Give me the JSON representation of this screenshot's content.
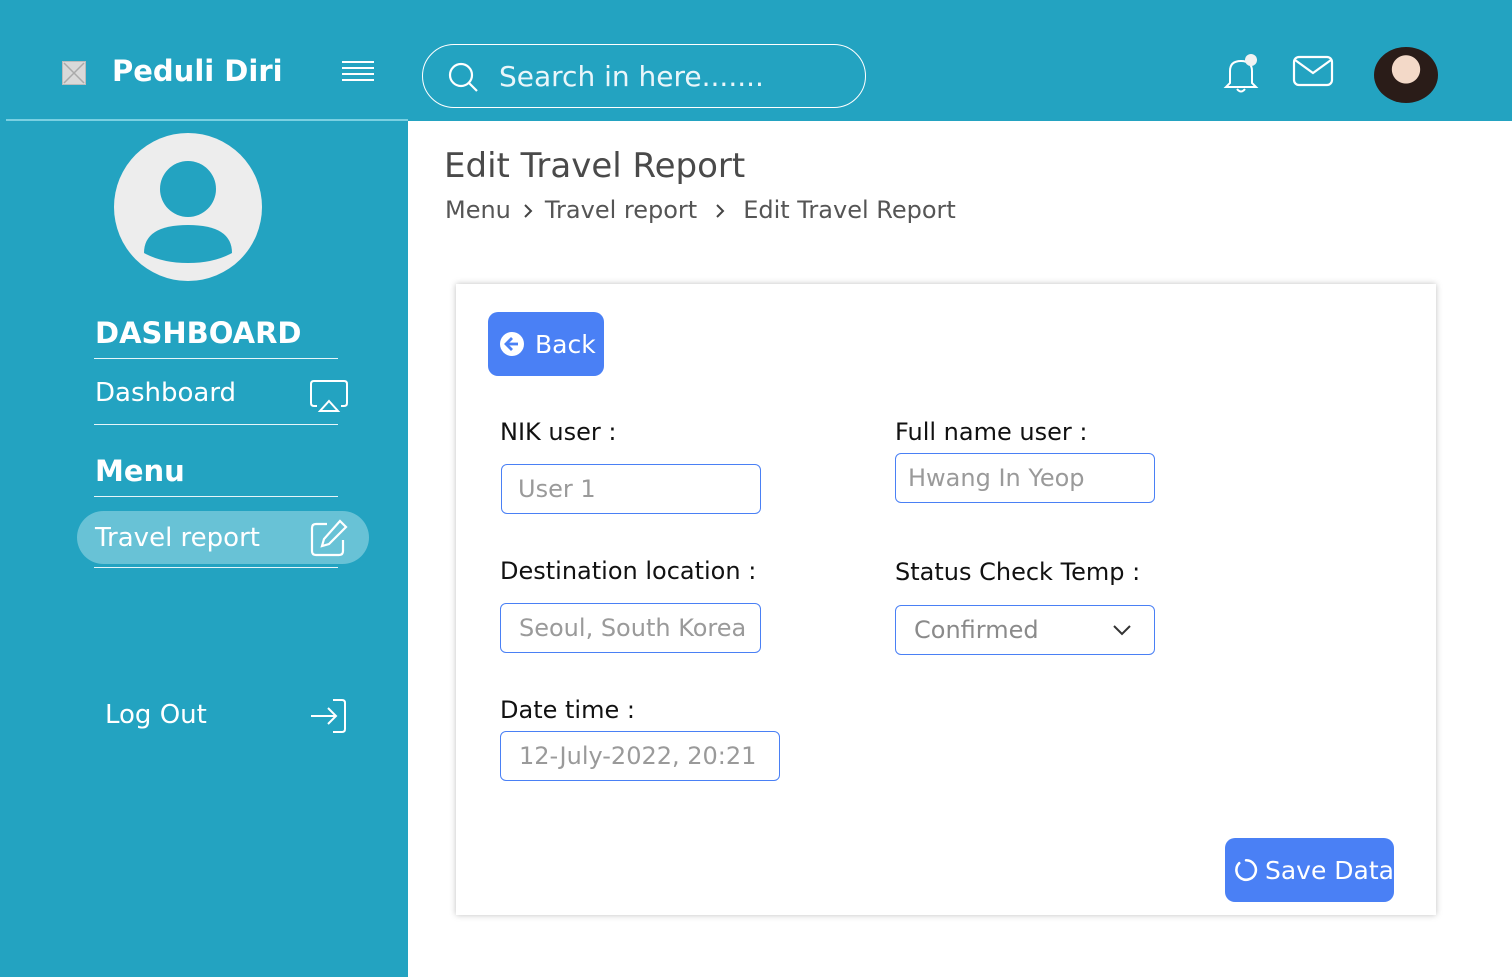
{
  "app": {
    "title": "Peduli Diri"
  },
  "search": {
    "placeholder": "Search in here......."
  },
  "sidebar": {
    "section_dashboard": "DASHBOARD",
    "dashboard_item": "Dashboard",
    "section_menu": "Menu",
    "travel_report_item": "Travel report",
    "logout": "Log Out"
  },
  "page": {
    "title": "Edit Travel Report",
    "breadcrumb": [
      "Menu",
      "Travel report",
      "Edit Travel Report"
    ]
  },
  "form": {
    "back_label": "Back",
    "nik_label": "NIK user :",
    "nik_placeholder": "User 1",
    "fullname_label": "Full name user :",
    "fullname_placeholder": "Hwang In Yeop",
    "destination_label": "Destination location :",
    "destination_placeholder": "Seoul, South Korea",
    "status_label": "Status Check Temp :",
    "status_value": "Confirmed",
    "datetime_label": "Date time :",
    "datetime_placeholder": "12-July-2022, 20:21",
    "save_label": "Save Data"
  },
  "colors": {
    "primary_bar": "#23a3c1",
    "accent_button": "#4a80f5",
    "active_item_bg": "#68c2d6"
  },
  "icons": {
    "logo": "broken-image-icon",
    "menu": "hamburger-icon",
    "search": "search-icon",
    "notifications": "bell-icon",
    "messages": "mail-icon",
    "dashboard": "airplay-icon",
    "travel_report": "edit-icon",
    "logout": "logout-icon",
    "back": "arrow-left-circle-icon",
    "save": "loading-circle-icon"
  }
}
